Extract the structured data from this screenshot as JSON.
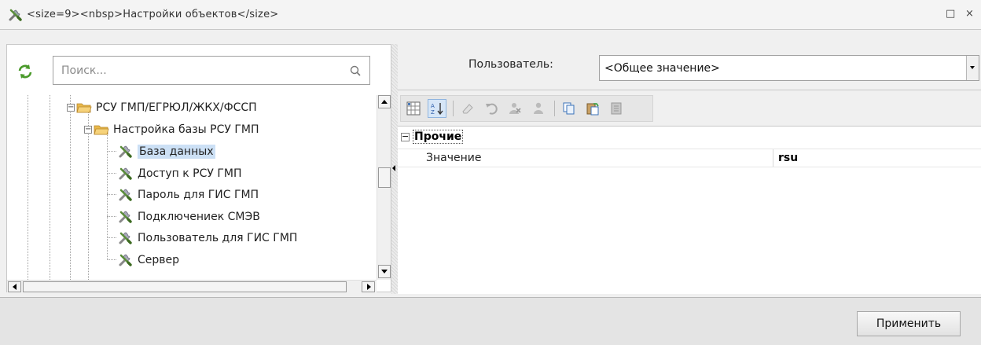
{
  "window": {
    "title": "<size=9><nbsp>Настройки объектов</size>",
    "maximize_glyph": "□",
    "close_glyph": "×"
  },
  "search": {
    "placeholder": "Поиск..."
  },
  "tree": {
    "items": [
      {
        "label": "РСУ ГМП/ЕГРЮЛ/ЖКХ/ФССП",
        "type": "folder",
        "expanded": true
      },
      {
        "label": "Настройка базы РСУ ГМП",
        "type": "folder",
        "expanded": true
      },
      {
        "label": "База данных",
        "type": "setting",
        "selected": true
      },
      {
        "label": "Доступ к РСУ ГМП",
        "type": "setting"
      },
      {
        "label": "Пароль для ГИС ГМП",
        "type": "setting"
      },
      {
        "label": "Подключениек СМЭВ",
        "type": "setting"
      },
      {
        "label": "Пользователь для ГИС ГМП",
        "type": "setting"
      },
      {
        "label": "Сервер",
        "type": "setting"
      }
    ]
  },
  "user": {
    "label": "Пользователь:",
    "selected_value": "<Общее значение>"
  },
  "toolbar": {
    "buttons": [
      "categorized-icon",
      "sort-az-icon",
      "eraser-icon",
      "undo-icon",
      "remove-user-icon",
      "user-icon",
      "copy-icon",
      "paste-icon",
      "document-icon"
    ]
  },
  "grid": {
    "group": {
      "label": "Прочие",
      "expanded": true
    },
    "rows": [
      {
        "name": "Значение",
        "value": "rsu"
      }
    ]
  },
  "footer": {
    "apply_label": "Применить"
  },
  "colors": {
    "selection": "#cce0f5",
    "folder": "#f2c94c",
    "panel_bg": "#f0f0f0"
  }
}
